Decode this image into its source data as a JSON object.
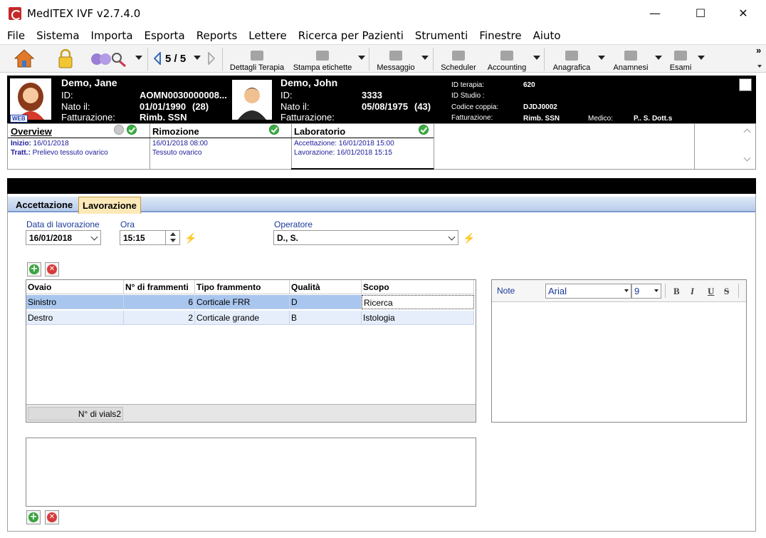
{
  "window": {
    "title": "MedITEX IVF v2.7.4.0",
    "minimize": "—",
    "maximize": "☐",
    "close": "✕"
  },
  "menu": [
    "File",
    "Sistema",
    "Importa",
    "Esporta",
    "Reports",
    "Lettere",
    "Ricerca per Pazienti",
    "Strumenti",
    "Finestre",
    "Aiuto"
  ],
  "toolbar": {
    "nav": "5 / 5",
    "buttons": {
      "dettagli": "Dettagli Terapia",
      "stampa": "Stampa etichette",
      "messaggio": "Messaggio",
      "scheduler": "Scheduler",
      "accounting": "Accounting",
      "anagrafica": "Anagrafica",
      "anamnesi": "Anamnesi",
      "esami": "Esami"
    },
    "overflow": "»"
  },
  "patient": {
    "female": {
      "name": "Demo, Jane",
      "id_label": "ID:",
      "id": "AOMN0030000008...",
      "born_label": "Nato il:",
      "born": "01/01/1990",
      "age": "(28)",
      "billing_label": "Fatturazione:",
      "billing": "Rimb. SSN",
      "web_badge": "WEB"
    },
    "male": {
      "name": "Demo, John",
      "id_label": "ID:",
      "id": "3333",
      "born_label": "Nato il:",
      "born": "05/08/1975",
      "age": "(43)",
      "billing_label": "Fatturazione:"
    },
    "therapy": {
      "id_terapia_label": "ID terapia:",
      "id_terapia": "620",
      "id_studio_label": "ID Studio :",
      "codice_label": "Codice coppia:",
      "codice": "DJDJ0002",
      "billing_label": "Fatturazione:",
      "billing": "Rimb. SSN",
      "medico_label": "Medico:",
      "medico": "P.. S. Dott.s"
    }
  },
  "status_tabs": {
    "overview": {
      "title": "Overview",
      "line1_label": "Inizio:",
      "line1": "16/01/2018",
      "line2_label": "Tratt.:",
      "line2": "Prelievo tessuto ovarico"
    },
    "rimozione": {
      "title": "Rimozione",
      "line1": "16/01/2018 08:00",
      "line2": "Tessuto ovarico"
    },
    "laboratorio": {
      "title": "Laboratorio",
      "line1": "Accettazione: 16/01/2018 15:00",
      "line2": "Lavorazione: 16/01/2018 15:15"
    }
  },
  "subtabs": {
    "accettazione": "Accettazione",
    "lavorazione": "Lavorazione"
  },
  "form": {
    "date_label": "Data di lavorazione",
    "date": "16/01/2018",
    "time_label": "Ora",
    "time": "15:15",
    "operator_label": "Operatore",
    "operator": "D., S."
  },
  "grid": {
    "columns": [
      "Ovaio",
      "N° di frammenti",
      "Tipo frammento",
      "Qualità",
      "Scopo"
    ],
    "rows": [
      [
        "Sinistro",
        "6",
        "Corticale FRR",
        "D",
        "Ricerca"
      ],
      [
        "Destro",
        "2",
        "Corticale grande",
        "B",
        "Istologia"
      ]
    ],
    "footer_label": "N° di vials",
    "footer_value": "2"
  },
  "notes": {
    "label": "Note",
    "font": "Arial",
    "size": "9",
    "bold": "B",
    "italic": "I",
    "underline": "U",
    "strike": "S"
  }
}
